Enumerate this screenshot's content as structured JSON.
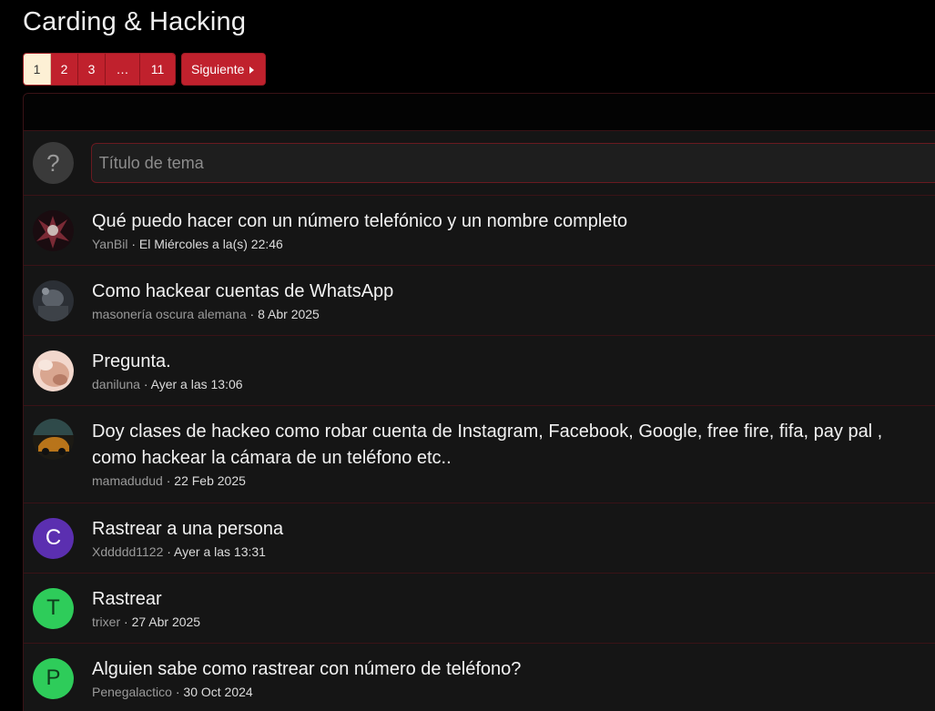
{
  "page": {
    "title": "Carding & Hacking"
  },
  "pagination": {
    "pages": [
      "1",
      "2",
      "3",
      "…",
      "11"
    ],
    "current": "1",
    "next_label": "Siguiente"
  },
  "new_thread": {
    "avatar_glyph": "?",
    "placeholder": "Título de tema"
  },
  "threads": [
    {
      "title": "Qué puedo hacer con un número telefónico y un nombre completo",
      "author": "YanBil",
      "date": "El Miércoles a la(s) 22:46",
      "avatar": {
        "type": "image",
        "icon": "winged-knight-avatar",
        "color": "#7a2a35"
      }
    },
    {
      "title": "Como hackear cuentas de WhatsApp",
      "author": "masonería oscura alemana",
      "date": "8 Abr 2025",
      "avatar": {
        "type": "image",
        "icon": "grey-photo-avatar",
        "color": "#5a6068"
      }
    },
    {
      "title": "Pregunta.",
      "author": "daniluna",
      "date": "Ayer a las 13:06",
      "avatar": {
        "type": "image",
        "icon": "skin-photo-avatar",
        "color": "#d9a690"
      }
    },
    {
      "title_line1": "Doy clases de hackeo como robar cuenta de Instagram, Facebook, Google, free fire, fifa, pay pal ,",
      "title_line2": "como hackear la cámara de un teléfono etc..",
      "author": "mamadudud",
      "date": "22 Feb 2025",
      "avatar": {
        "type": "image",
        "icon": "car-photo-avatar",
        "color": "#6a4a1a"
      }
    },
    {
      "title": "Rastrear a una persona",
      "author": "Xddddd1122",
      "date": "Ayer a las 13:31",
      "avatar": {
        "type": "letter",
        "letter": "C",
        "color": "#5b2fb0",
        "text_color": "#ffffff"
      }
    },
    {
      "title": "Rastrear",
      "author": "trixer",
      "date": "27 Abr 2025",
      "avatar": {
        "type": "letter",
        "letter": "T",
        "color": "#2ecc5a",
        "text_color": "#0f3d1c"
      }
    },
    {
      "title": "Alguien sabe como rastrear con número de teléfono?",
      "author": "Penegalactico",
      "date": "30 Oct 2024",
      "avatar": {
        "type": "letter",
        "letter": "P",
        "color": "#2ecc5a",
        "text_color": "#0f3d1c"
      }
    }
  ]
}
